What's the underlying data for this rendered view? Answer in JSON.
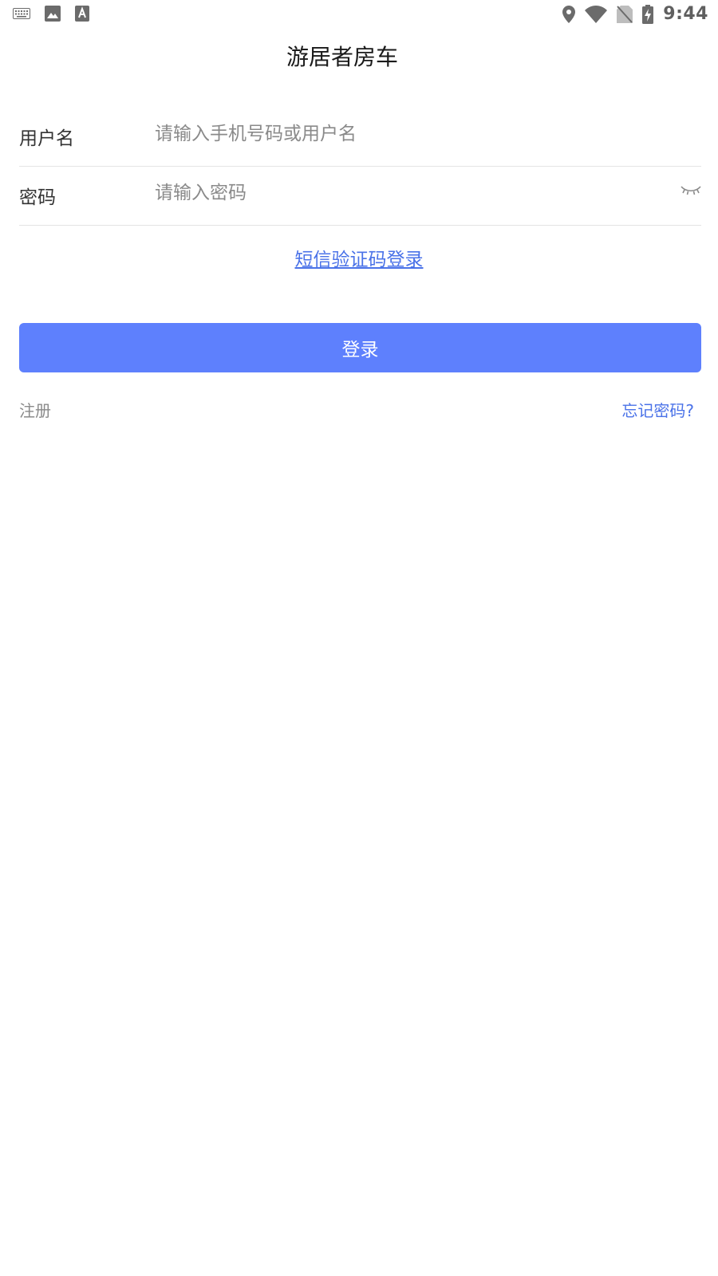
{
  "status_bar": {
    "time": "9:44",
    "left_icons": [
      "keyboard-icon",
      "image-icon",
      "text-a-icon"
    ],
    "right_icons": [
      "location-icon",
      "wifi-icon",
      "no-sim-icon",
      "battery-charging-icon"
    ]
  },
  "app": {
    "title": "游居者房车"
  },
  "form": {
    "username": {
      "label": "用户名",
      "placeholder": "请输入手机号码或用户名",
      "value": ""
    },
    "password": {
      "label": "密码",
      "placeholder": "请输入密码",
      "value": "",
      "toggle_icon": "eye-closed-icon"
    },
    "sms_login_link": "短信验证码登录",
    "submit_label": "登录"
  },
  "footer": {
    "register_label": "注册",
    "forgot_password_label": "忘记密码?"
  },
  "colors": {
    "primary": "#5e80fd",
    "link": "#4a72e8",
    "label": "#333333",
    "placeholder": "#8a8a8a",
    "divider": "#e4e4e4"
  }
}
